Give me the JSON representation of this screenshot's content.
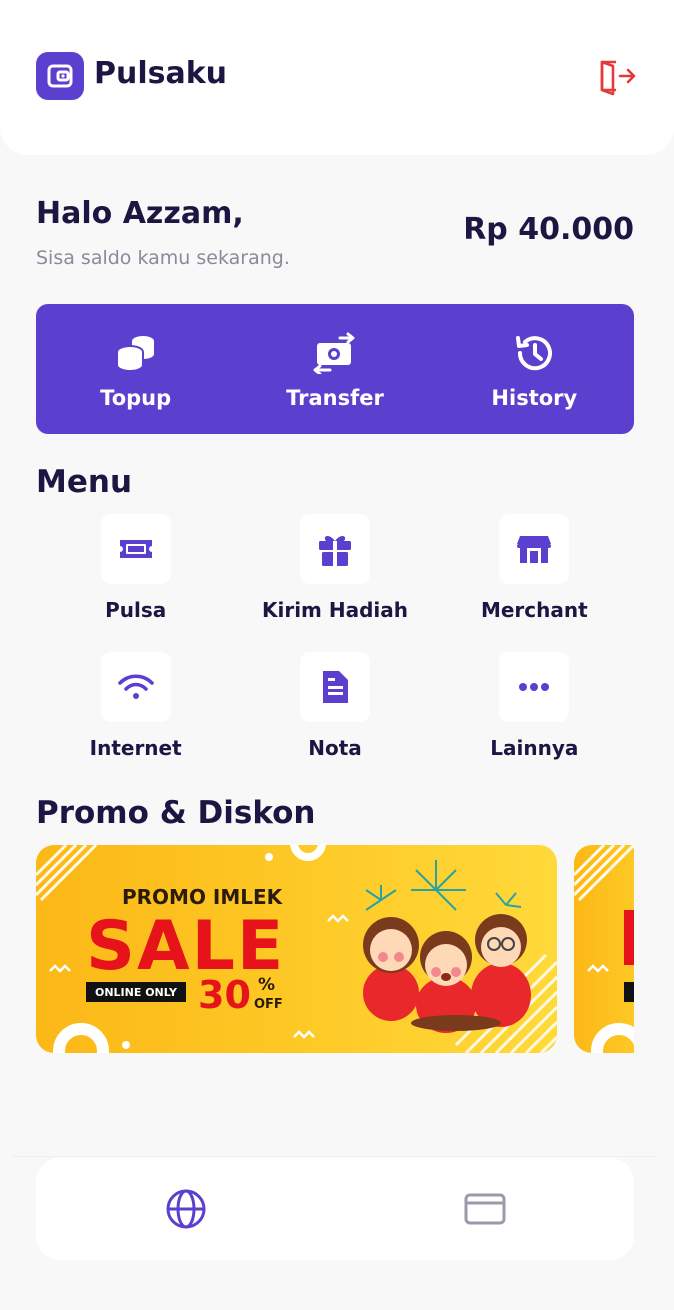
{
  "header": {
    "brand": "Pulsaku",
    "icons": {
      "logo": "wallet-icon",
      "logout": "logout-icon"
    }
  },
  "colors": {
    "primary": "#5b3fcf",
    "logout": "#e5393b",
    "text": "#1c1642",
    "muted": "#8a8a9a"
  },
  "account": {
    "greeting": "Halo Azzam,",
    "subtitle": "Sisa saldo kamu sekarang.",
    "balance": "Rp 40.000"
  },
  "quick_actions": [
    {
      "label": "Topup",
      "icon": "coins-icon"
    },
    {
      "label": "Transfer",
      "icon": "money-transfer-icon"
    },
    {
      "label": "History",
      "icon": "history-icon"
    }
  ],
  "menu": {
    "title": "Menu",
    "items": [
      {
        "label": "Pulsa",
        "icon": "ticket-icon"
      },
      {
        "label": "Kirim Hadiah",
        "icon": "gift-icon"
      },
      {
        "label": "Merchant",
        "icon": "store-icon"
      },
      {
        "label": "Internet",
        "icon": "wifi-icon"
      },
      {
        "label": "Nota",
        "icon": "receipt-icon"
      },
      {
        "label": "Lainnya",
        "icon": "more-icon"
      }
    ]
  },
  "promo": {
    "title": "Promo & Diskon",
    "banners": [
      {
        "heading": "PROMO IMLEK",
        "big": "SALE",
        "tag": "ONLINE ONLY",
        "percent": "30",
        "percent_sign": "%",
        "off": "OFF"
      }
    ]
  },
  "bottom_nav": [
    {
      "name": "home",
      "icon": "globe-icon",
      "active": true
    },
    {
      "name": "card",
      "icon": "card-icon",
      "active": false
    }
  ]
}
